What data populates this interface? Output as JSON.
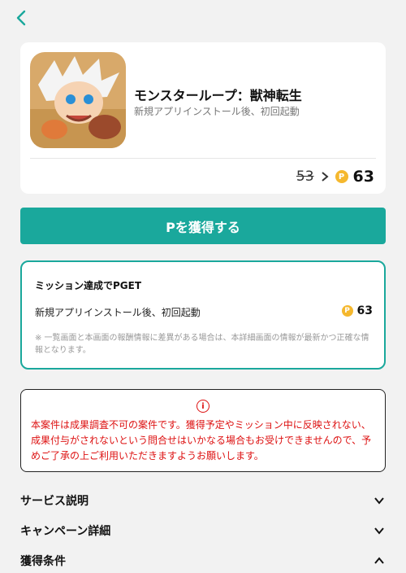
{
  "nav": {
    "back_icon": "chevron-left-icon"
  },
  "app": {
    "title": "モンスターループ：獣神転生",
    "subtitle": "新規アプリインストール後、初回起動",
    "old_points": "53",
    "new_points": "63",
    "coin_symbol": "P"
  },
  "get_button_label": "Pを獲得する",
  "mission": {
    "title": "ミッション達成でPGET",
    "item_label": "新規アプリインストール後、初回起動",
    "item_points": "63",
    "note": "※ 一覧画面と本画面の報酬情報に差異がある場合は、本詳細画面の情報が最新かつ正確な情報となります。"
  },
  "warning": {
    "icon_symbol": "i",
    "text": "本案件は成果調査不可の案件です。獲得予定やミッション中に反映されない、成果付与がされないという問合せはいかなる場合もお受けできませんので、予めご了承の上ご利用いただきますようお願いします。"
  },
  "sections": [
    {
      "label": "サービス説明",
      "state": "collapsed"
    },
    {
      "label": "キャンペーン詳細",
      "state": "collapsed"
    },
    {
      "label": "獲得条件",
      "state": "expanded"
    }
  ],
  "colors": {
    "accent": "#1aa89c",
    "coin": "#f5b82e",
    "warning": "#dd1111"
  }
}
